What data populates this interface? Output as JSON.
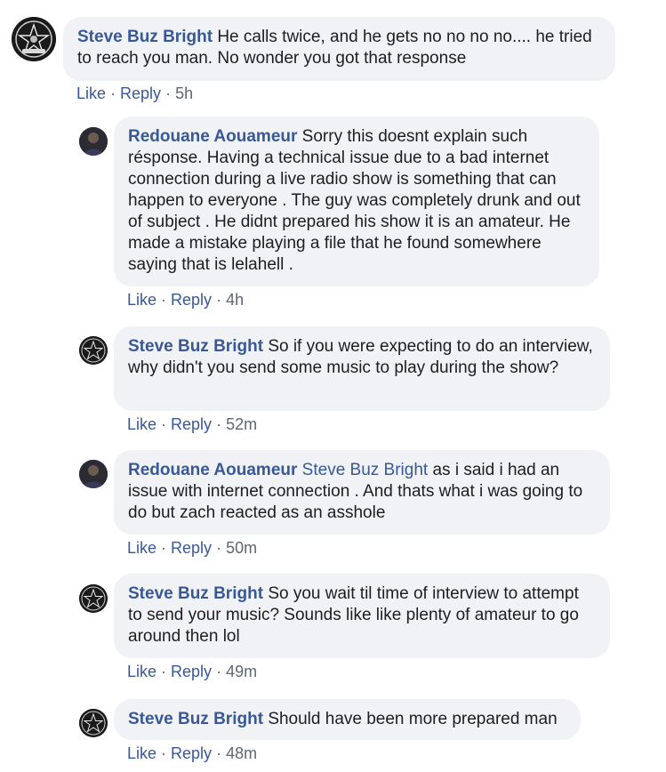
{
  "comments": [
    {
      "author": "Steve Buz Bright",
      "tag": "",
      "text": "He calls twice, and he gets no no no no.... he tried to reach you man. No wonder you got that response",
      "like": "Like",
      "reply": "Reply",
      "time": "5h"
    },
    {
      "author": "Redouane Aouameur",
      "tag": "",
      "text": "Sorry this doesnt explain such résponse. Having a technical issue due to a bad internet connection during a live radio show is something that can happen to everyone . The guy was completely drunk and out of subject . He didnt prepared his show it is an amateur. He made a mistake playing a file that he found somewhere saying that is lelahell .",
      "like": "Like",
      "reply": "Reply",
      "time": "4h"
    },
    {
      "author": "Steve Buz Bright",
      "tag": "",
      "text": "So if you were expecting to do an interview, why didn't you send some music to play during the show?",
      "like": "Like",
      "reply": "Reply",
      "time": "52m"
    },
    {
      "author": "Redouane Aouameur",
      "tag": "Steve Buz Bright",
      "text": "as i said i had an issue with internet connection . And thats what i was going to do but zach reacted as an asshole",
      "like": "Like",
      "reply": "Reply",
      "time": "50m"
    },
    {
      "author": "Steve Buz Bright",
      "tag": "",
      "text": "So you wait til time of interview to attempt to send your music? Sounds like like plenty of amateur to go around then lol",
      "like": "Like",
      "reply": "Reply",
      "time": "49m"
    },
    {
      "author": "Steve Buz Bright",
      "tag": "",
      "text": "Should have been more prepared man",
      "like": "Like",
      "reply": "Reply",
      "time": "48m"
    }
  ],
  "separator": "·",
  "colors": {
    "link": "#385898",
    "bubble": "#f0f2f5",
    "meta": "#606770",
    "text": "#1c1e21"
  },
  "icons": {
    "steve_avatar": "pentagram-badge-avatar",
    "redouane_avatar": "person-photo-avatar"
  }
}
